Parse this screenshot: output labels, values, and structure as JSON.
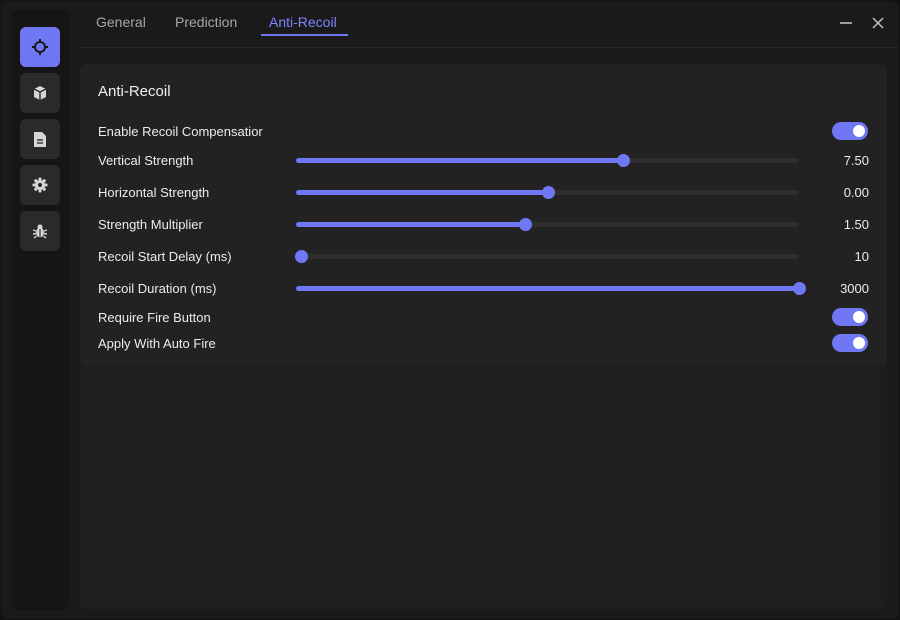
{
  "tabs": [
    {
      "label": "General",
      "active": false
    },
    {
      "label": "Prediction",
      "active": false
    },
    {
      "label": "Anti-Recoil",
      "active": true
    }
  ],
  "sidebar": {
    "items": [
      {
        "icon": "crosshair-icon",
        "active": true
      },
      {
        "icon": "cube-icon",
        "active": false
      },
      {
        "icon": "document-icon",
        "active": false
      },
      {
        "icon": "gear-icon",
        "active": false
      },
      {
        "icon": "bug-icon",
        "active": false
      }
    ]
  },
  "panel": {
    "title": "Anti-Recoil",
    "enable_recoil": {
      "label": "Enable Recoil Compensatior",
      "on": true
    },
    "sliders": [
      {
        "label": "Vertical Strength",
        "value": "7.50",
        "fraction": 0.65
      },
      {
        "label": "Horizontal Strength",
        "value": "0.00",
        "fraction": 0.5
      },
      {
        "label": "Strength Multiplier",
        "value": "1.50",
        "fraction": 0.455
      },
      {
        "label": "Recoil Start Delay (ms)",
        "value": "10",
        "fraction": 0.01
      },
      {
        "label": "Recoil Duration (ms)",
        "value": "3000",
        "fraction": 1.0
      }
    ],
    "require_fire": {
      "label": "Require Fire Button",
      "on": true
    },
    "auto_fire": {
      "label": "Apply With Auto Fire",
      "on": true
    }
  },
  "colors": {
    "accent": "#6f77f5",
    "background": "#1a1a1a",
    "card": "#222222"
  }
}
